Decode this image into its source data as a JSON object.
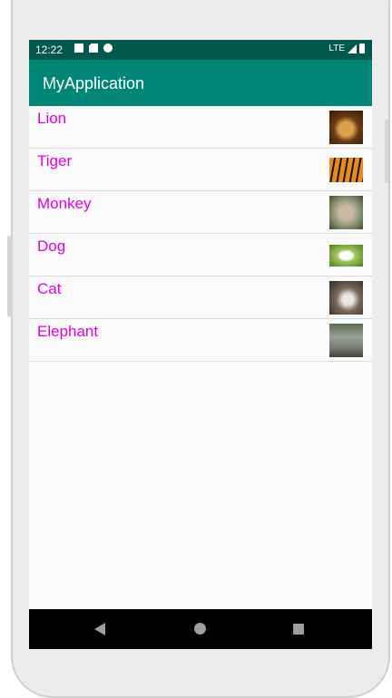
{
  "status_bar": {
    "time": "12:22",
    "network": "LTE",
    "icons": [
      "a-icon",
      "sd-card-icon",
      "g-icon",
      "signal-icon",
      "battery-icon"
    ]
  },
  "app_bar": {
    "title": "MyApplication"
  },
  "list": {
    "items": [
      {
        "label": "Lion",
        "image": "lion-thumbnail"
      },
      {
        "label": "Tiger",
        "image": "tiger-thumbnail"
      },
      {
        "label": "Monkey",
        "image": "monkey-thumbnail"
      },
      {
        "label": "Dog",
        "image": "dog-thumbnail"
      },
      {
        "label": "Cat",
        "image": "cat-thumbnail"
      },
      {
        "label": "Elephant",
        "image": "elephant-thumbnail"
      }
    ]
  },
  "nav_bar": {
    "buttons": [
      "back-icon",
      "home-icon",
      "recents-icon"
    ]
  },
  "colors": {
    "status_bar": "#00574b",
    "app_bar": "#008577",
    "item_text": "#e000e0",
    "nav_bar": "#000000"
  }
}
